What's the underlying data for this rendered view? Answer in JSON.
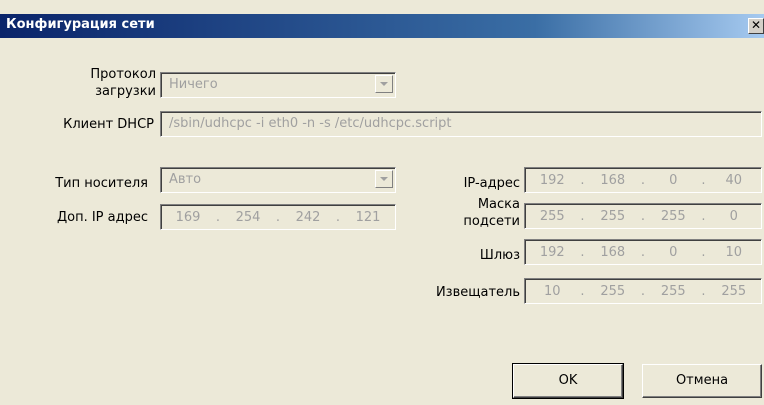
{
  "window": {
    "title": "Конфигурация сети",
    "close_glyph": "✕"
  },
  "labels": {
    "boot_protocol_line1": "Протокол",
    "boot_protocol_line2": "загрузки",
    "dhcp_client": "Клиент DHCP",
    "media_type": "Тип носителя",
    "extra_ip": "Доп. IP адрес",
    "ip_address": "IP-адрес",
    "subnet_mask_line1": "Маска",
    "subnet_mask_line2": "подсети",
    "gateway": "Шлюз",
    "notifier": "Извещатель"
  },
  "fields": {
    "boot_protocol": "Ничего",
    "dhcp_client": "/sbin/udhcpc -i eth0 -n -s /etc/udhcpc.script",
    "media_type": "Авто"
  },
  "ip": {
    "extra_ip": [
      "169",
      "254",
      "242",
      "121"
    ],
    "ip_address": [
      "192",
      "168",
      "0",
      "40"
    ],
    "subnet_mask": [
      "255",
      "255",
      "255",
      "0"
    ],
    "gateway": [
      "192",
      "168",
      "0",
      "10"
    ],
    "notifier": [
      "10",
      "255",
      "255",
      "255"
    ]
  },
  "buttons": {
    "ok": "OK",
    "cancel": "Отмена"
  },
  "colors": {
    "title_start": "#0a246a",
    "dialog_bg": "#ece9d8",
    "disabled_text": "#a0a0a0"
  }
}
